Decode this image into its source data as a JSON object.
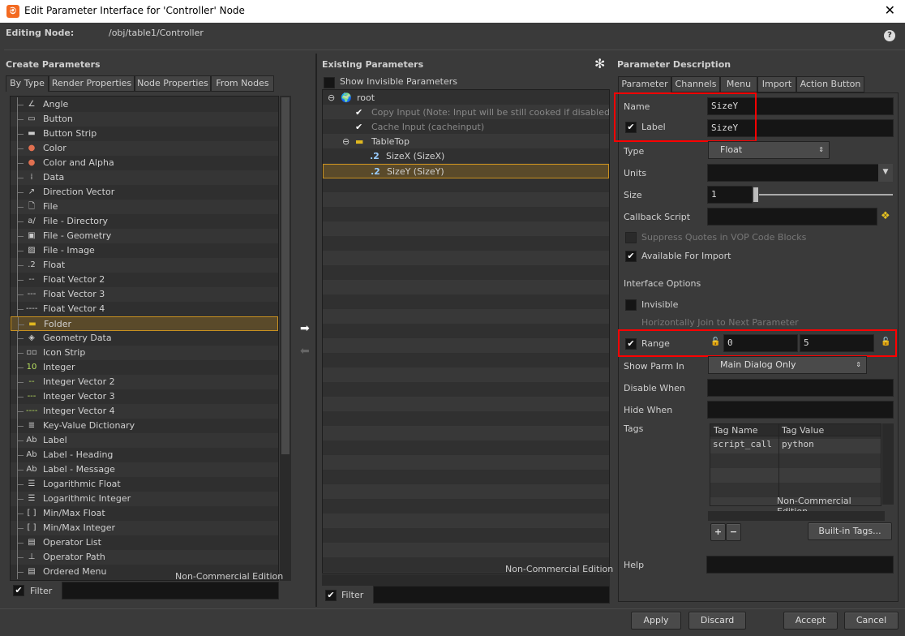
{
  "window": {
    "title": "Edit Parameter Interface for 'Controller' Node",
    "close": "✕",
    "logo": "houdini-logo"
  },
  "editing_node": {
    "label": "Editing Node:",
    "value": "/obj/table1/Controller",
    "help": "?"
  },
  "create": {
    "title": "Create Parameters",
    "tabs": [
      "By Type",
      "Render Properties",
      "Node Properties",
      "From Nodes"
    ],
    "items": [
      {
        "label": "Angle",
        "icon": "∠"
      },
      {
        "label": "Button",
        "icon": "▭"
      },
      {
        "label": "Button Strip",
        "icon": "▬"
      },
      {
        "label": "Color",
        "icon": "●"
      },
      {
        "label": "Color and Alpha",
        "icon": "●"
      },
      {
        "label": "Data",
        "icon": "⁞"
      },
      {
        "label": "Direction Vector",
        "icon": "↗"
      },
      {
        "label": "File",
        "icon": "🗋"
      },
      {
        "label": "File - Directory",
        "icon": "a/"
      },
      {
        "label": "File - Geometry",
        "icon": "▣"
      },
      {
        "label": "File - Image",
        "icon": "▨"
      },
      {
        "label": "Float",
        "icon": ".2"
      },
      {
        "label": "Float Vector 2",
        "icon": "--"
      },
      {
        "label": "Float Vector 3",
        "icon": "---"
      },
      {
        "label": "Float Vector 4",
        "icon": "----"
      },
      {
        "label": "Folder",
        "icon": "▬"
      },
      {
        "label": "Geometry Data",
        "icon": "◈"
      },
      {
        "label": "Icon Strip",
        "icon": "▫▫"
      },
      {
        "label": "Integer",
        "icon": "10"
      },
      {
        "label": "Integer Vector 2",
        "icon": "--"
      },
      {
        "label": "Integer Vector 3",
        "icon": "---"
      },
      {
        "label": "Integer Vector 4",
        "icon": "----"
      },
      {
        "label": "Key-Value Dictionary",
        "icon": "≣"
      },
      {
        "label": "Label",
        "icon": "Ab"
      },
      {
        "label": "Label - Heading",
        "icon": "Ab"
      },
      {
        "label": "Label - Message",
        "icon": "Ab"
      },
      {
        "label": "Logarithmic Float",
        "icon": "☰"
      },
      {
        "label": "Logarithmic Integer",
        "icon": "☰"
      },
      {
        "label": "Min/Max Float",
        "icon": "[ ]"
      },
      {
        "label": "Min/Max Integer",
        "icon": "[ ]"
      },
      {
        "label": "Operator List",
        "icon": "▤"
      },
      {
        "label": "Operator Path",
        "icon": "⊥"
      },
      {
        "label": "Ordered Menu",
        "icon": "▤"
      }
    ],
    "selected": "Folder",
    "watermark": "Non-Commercial Edition",
    "filter_label": "Filter",
    "filter_value": ""
  },
  "existing": {
    "title": "Existing Parameters",
    "show_invisible": "Show Invisible Parameters",
    "tree": [
      {
        "label": "root",
        "level": 0,
        "icon": "globe",
        "dim": false
      },
      {
        "label": "Copy Input (Note: Input will be still cooked if disabled) (copyinput)",
        "level": 1,
        "icon": "check",
        "dim": true
      },
      {
        "label": "Cache Input (cacheinput)",
        "level": 1,
        "icon": "check",
        "dim": true
      },
      {
        "label": "TableTop",
        "level": 1,
        "icon": "folder",
        "dim": false
      },
      {
        "label": "SizeX (SizeX)",
        "level": 2,
        "icon": "float",
        "dim": false
      },
      {
        "label": "SizeY (SizeY)",
        "level": 2,
        "icon": "float",
        "dim": false,
        "selected": true
      }
    ],
    "watermark": "Non-Commercial Edition",
    "filter_label": "Filter",
    "filter_value": ""
  },
  "desc": {
    "title": "Parameter Description",
    "tabs": [
      "Parameter",
      "Channels",
      "Menu",
      "Import",
      "Action Button"
    ],
    "name_label": "Name",
    "name_value": "SizeY",
    "label_label": "Label",
    "label_value": "SizeY",
    "type_label": "Type",
    "type_value": "Float",
    "units_label": "Units",
    "units_value": "",
    "size_label": "Size",
    "size_value": "1",
    "callback_label": "Callback Script",
    "callback_value": "",
    "suppress": "Suppress Quotes in VOP Code Blocks",
    "available": "Available For Import",
    "interface_options": "Interface Options",
    "invisible": "Invisible",
    "hjoin": "Horizontally Join to Next Parameter",
    "range_label": "Range",
    "range_min": "0",
    "range_max": "5",
    "show_parm_label": "Show Parm In",
    "show_parm_value": "Main Dialog Only",
    "disable_when": "Disable When",
    "hide_when": "Hide When",
    "tags_label": "Tags",
    "tags_headers": [
      "Tag Name",
      "Tag Value"
    ],
    "tags_rows": [
      [
        "script_call",
        "python"
      ]
    ],
    "watermark": "Non-Commercial Edition",
    "add": "+",
    "remove": "−",
    "builtin": "Built-in Tags...",
    "help_label": "Help",
    "help_value": ""
  },
  "footer": {
    "apply": "Apply",
    "discard": "Discard",
    "accept": "Accept",
    "cancel": "Cancel"
  },
  "colors": {
    "highlight": "#ff0000",
    "selection": "#c89020"
  }
}
